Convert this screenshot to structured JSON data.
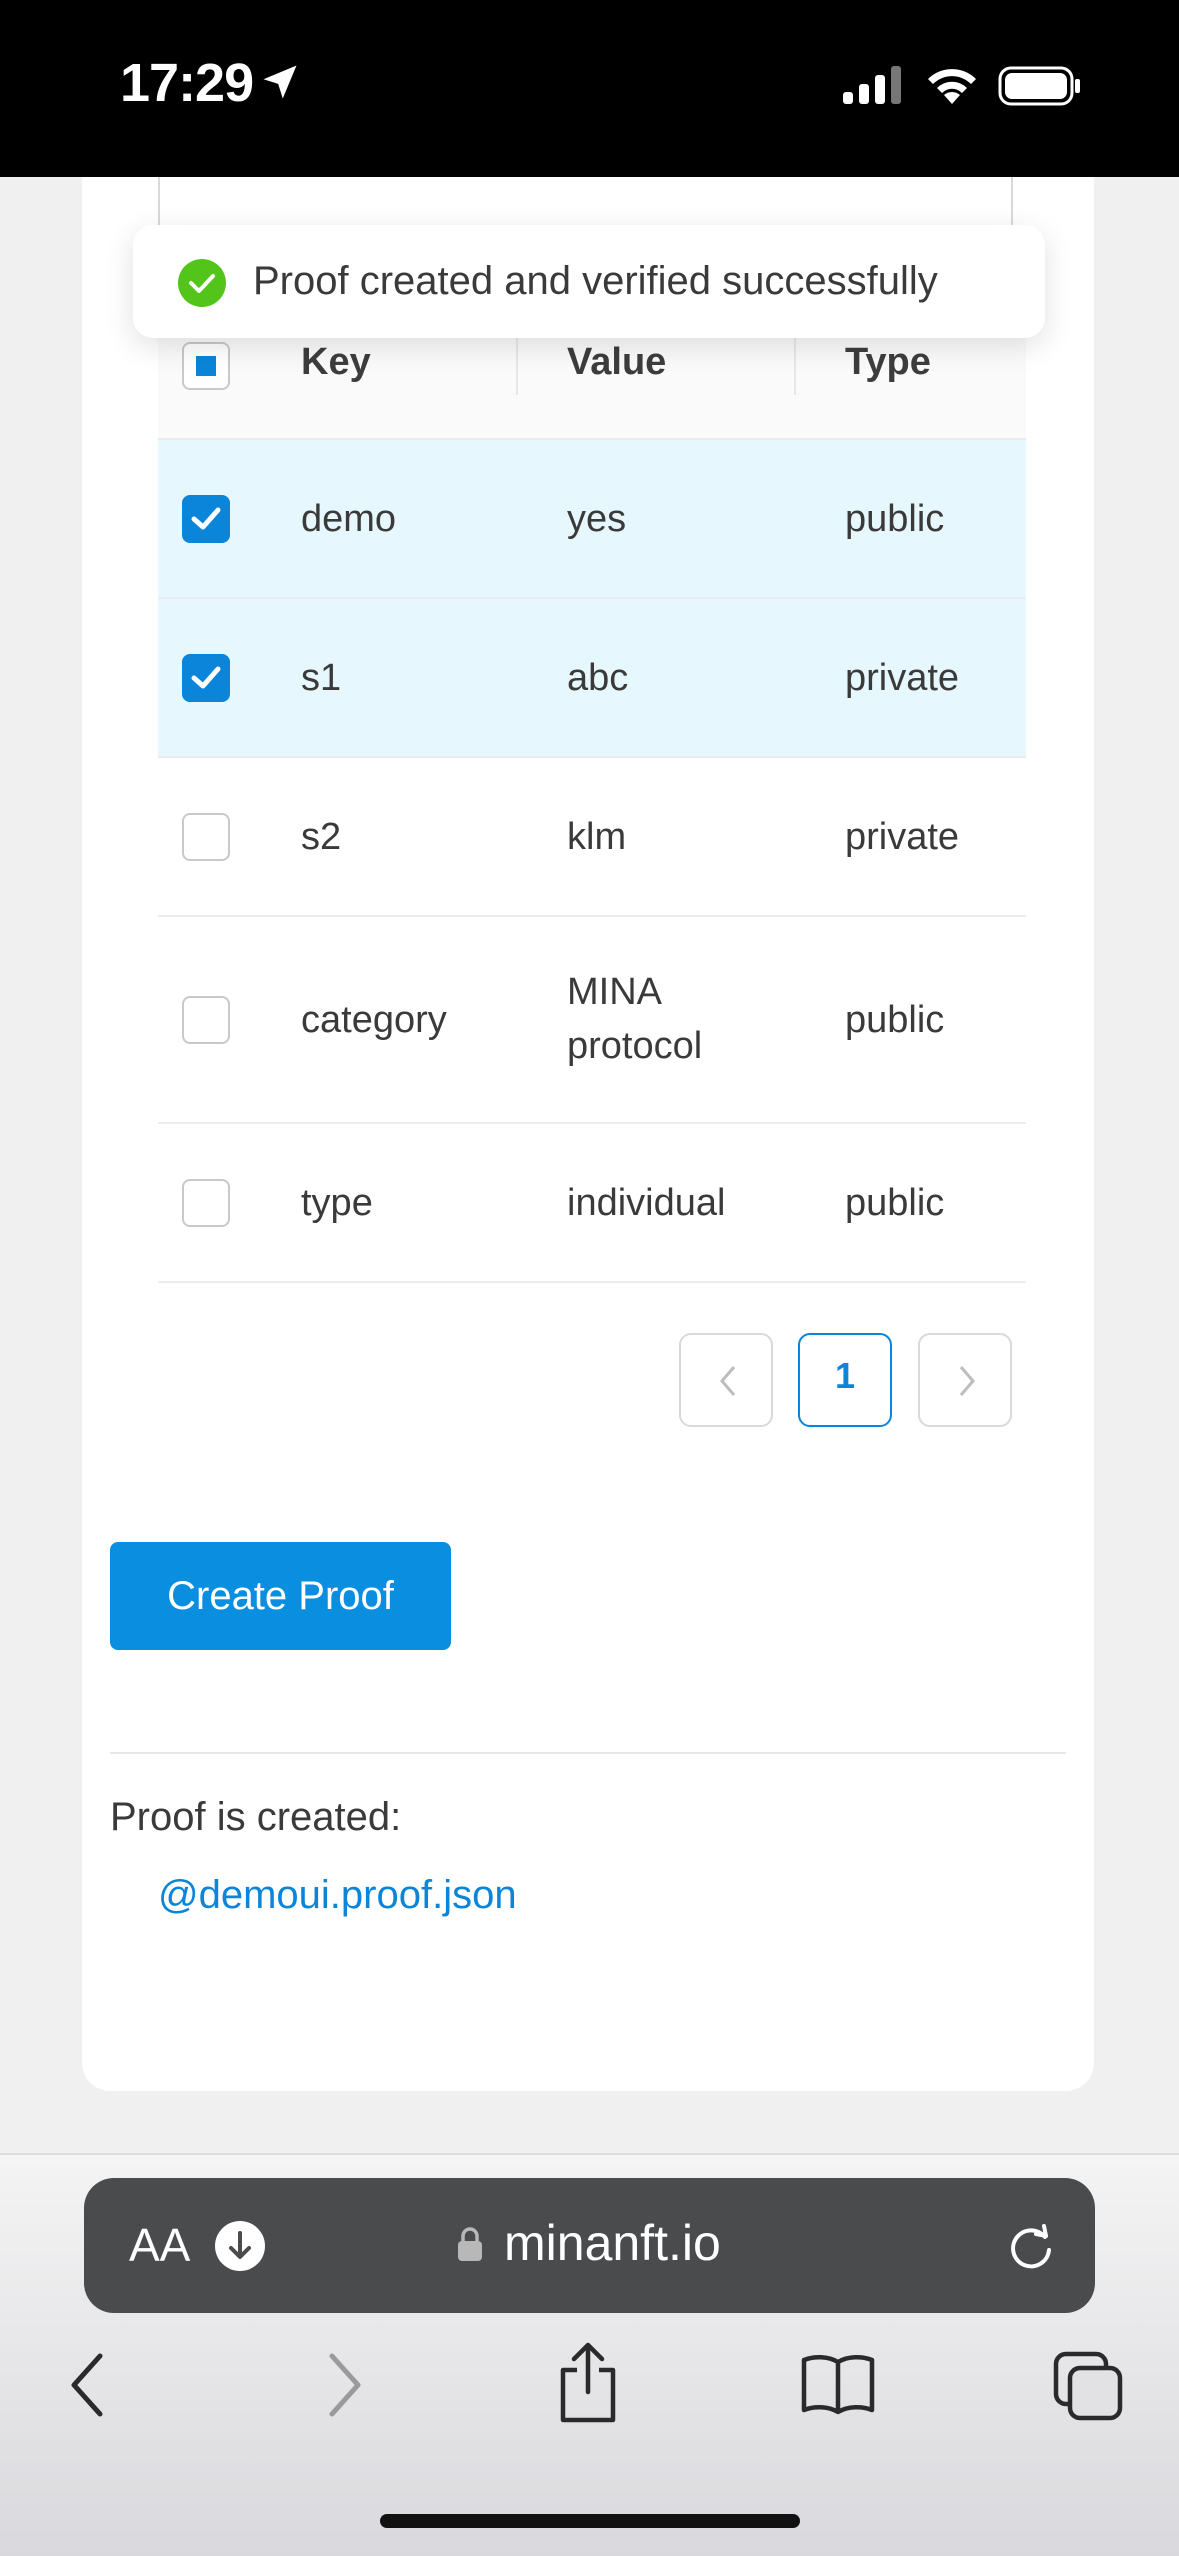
{
  "status_bar": {
    "time": "17:29"
  },
  "toast": {
    "message": "Proof created and verified successfully"
  },
  "table": {
    "columns": [
      "Key",
      "Value",
      "Type"
    ],
    "rows": [
      {
        "key": "demo",
        "value": "yes",
        "value_line2": "",
        "type": "public",
        "checked": true
      },
      {
        "key": "s1",
        "value": "abc",
        "value_line2": "",
        "type": "private",
        "checked": true
      },
      {
        "key": "s2",
        "value": "klm",
        "value_line2": "",
        "type": "private",
        "checked": false
      },
      {
        "key": "category",
        "value": "MINA",
        "value_line2": "protocol",
        "type": "public",
        "checked": false
      },
      {
        "key": "type",
        "value": "individual",
        "value_line2": "",
        "type": "public",
        "checked": false
      }
    ]
  },
  "pagination": {
    "current_page": "1"
  },
  "actions": {
    "create_proof": "Create Proof"
  },
  "result": {
    "label": "Proof is created:",
    "file_link": "@demoui.proof.json"
  },
  "browser": {
    "text_size": "AA",
    "url": "minanft.io"
  },
  "colors": {
    "accent": "#0a85d9",
    "selected_row": "#e6f7fd",
    "success": "#52c41a"
  }
}
